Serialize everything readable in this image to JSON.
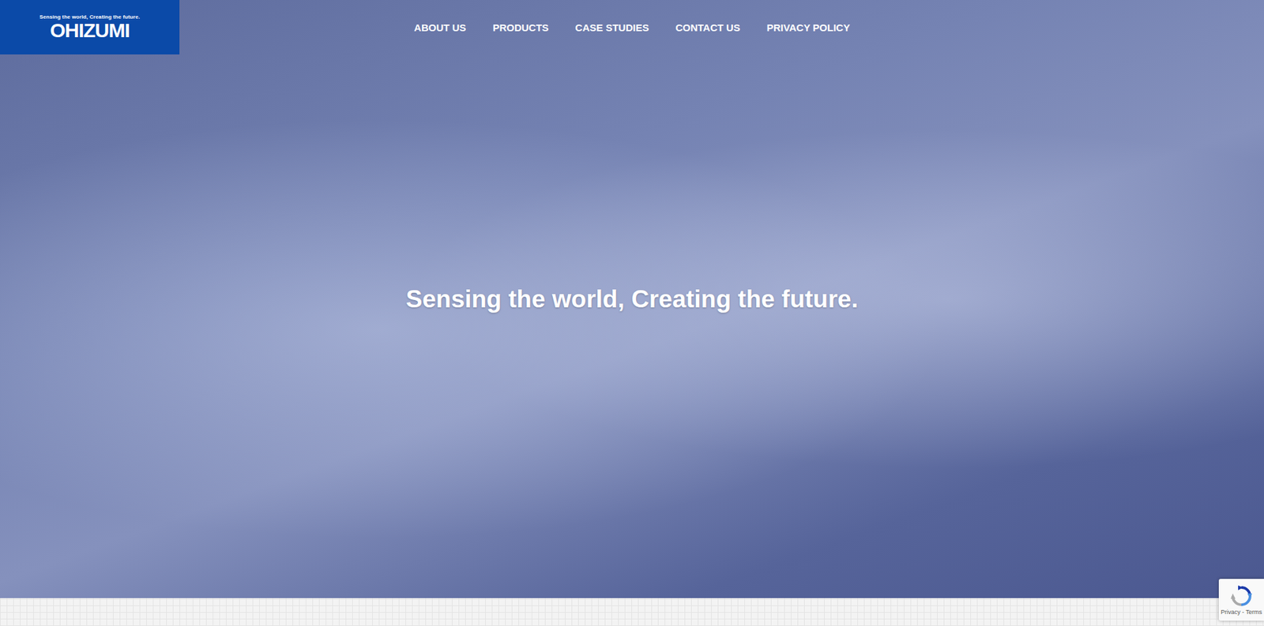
{
  "logo": {
    "tagline": "Sensing the world, Creating the future.",
    "name": "OHIZUMI"
  },
  "nav": [
    {
      "label": "ABOUT US"
    },
    {
      "label": "PRODUCTS"
    },
    {
      "label": "CASE STUDIES"
    },
    {
      "label": "CONTACT US"
    },
    {
      "label": "PRIVACY POLICY"
    }
  ],
  "hero": {
    "headline": "Sensing the world, Creating the future."
  },
  "recaptcha": {
    "links": "Privacy - Terms"
  }
}
